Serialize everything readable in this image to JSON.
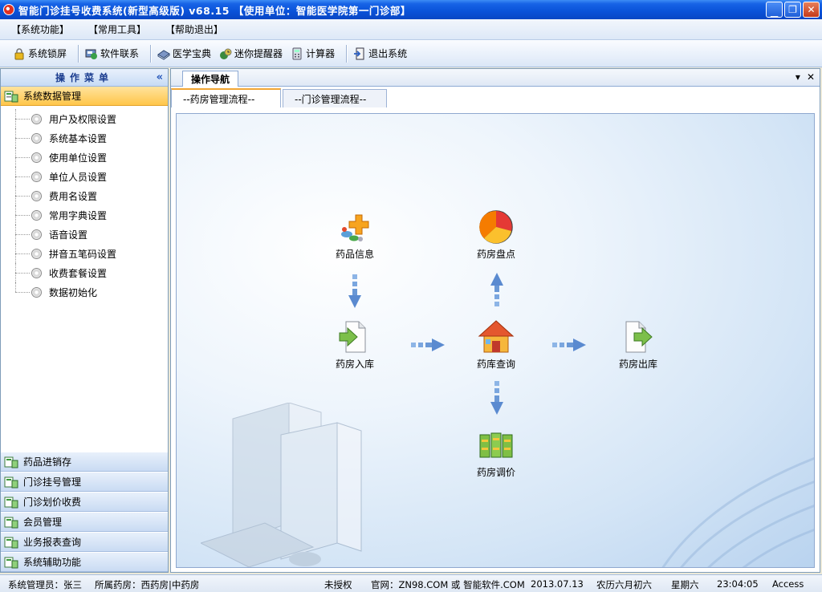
{
  "window": {
    "title": "智能门诊挂号收费系统(新型高级版) v68.15  【使用单位：智能医学院第一门诊部】"
  },
  "menu": [
    "【系统功能】",
    "【常用工具】",
    "【帮助退出】"
  ],
  "toolbar": [
    {
      "label": "系统锁屏",
      "icon": "lock-icon"
    },
    {
      "label": "软件联系",
      "icon": "contact-icon"
    },
    {
      "label": "医学宝典",
      "icon": "book-icon"
    },
    {
      "label": "迷你提醒器",
      "icon": "reminder-icon"
    },
    {
      "label": "计算器",
      "icon": "calculator-icon"
    },
    {
      "label": "退出系统",
      "icon": "exit-icon"
    }
  ],
  "left_panel": {
    "title": "操作菜单",
    "collapse": "«",
    "active_group": "系统数据管理",
    "items": [
      "用户及权限设置",
      "系统基本设置",
      "使用单位设置",
      "单位人员设置",
      "费用名设置",
      "常用字典设置",
      "语音设置",
      "拼音五笔码设置",
      "收费套餐设置",
      "数据初始化"
    ],
    "groups": [
      "药品进销存",
      "门诊挂号管理",
      "门诊划价收费",
      "会员管理",
      "业务报表查询",
      "系统辅助功能"
    ]
  },
  "doc_tab": {
    "label": "操作导航",
    "menu": "▾",
    "close": "✕"
  },
  "sub_tabs": [
    "--药房管理流程--",
    "--门诊管理流程--"
  ],
  "flow": {
    "nodes": [
      {
        "label": "药品信息",
        "icon": "medicine-icon"
      },
      {
        "label": "药房盘点",
        "icon": "pie-chart-icon"
      },
      {
        "label": "药房入库",
        "icon": "document-in-icon"
      },
      {
        "label": "药库查询",
        "icon": "house-icon"
      },
      {
        "label": "药房出库",
        "icon": "document-out-icon"
      },
      {
        "label": "药房调价",
        "icon": "money-stack-icon"
      }
    ]
  },
  "status": {
    "operator": "系统管理员：张三",
    "pharmacy": "所属药房：西药房|中药房",
    "license": "未授权",
    "website": "官网：ZN98.COM 或 智能软件.COM",
    "date": "2013.07.13",
    "lunar": "农历六月初六",
    "weekday": "星期六",
    "time": "23:04:05",
    "db": "Access"
  },
  "colors": {
    "title_bar": "#0a52d8",
    "active_group": "#ffc64a",
    "canvas": "#d4e5f6"
  }
}
